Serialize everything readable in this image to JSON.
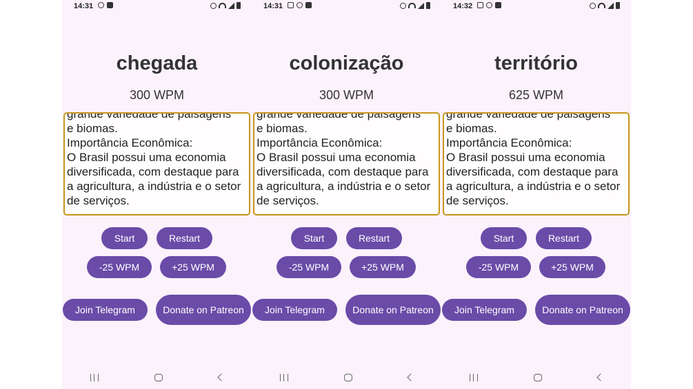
{
  "phones": [
    {
      "status": {
        "time": "14:31"
      },
      "word": "chegada",
      "wpm": "300 WPM",
      "text": "grande variedade de paisagens\ne biomas.\nImportância Econômica:\nO Brasil possui uma economia diversificada, com destaque para a agricultura, a indústria e o setor de serviços.",
      "buttons": {
        "start": "Start",
        "restart": "Restart",
        "minus": "-25 WPM",
        "plus": "+25 WPM",
        "telegram": "Join Telegram",
        "donate": "Donate on Patreon"
      }
    },
    {
      "status": {
        "time": "14:31"
      },
      "word": "colonização",
      "wpm": "300 WPM",
      "text": "grande variedade de paisagens\ne biomas.\nImportância Econômica:\nO Brasil possui uma economia diversificada, com destaque para a agricultura, a indústria e o setor de serviços.",
      "buttons": {
        "start": "Start",
        "restart": "Restart",
        "minus": "-25 WPM",
        "plus": "+25 WPM",
        "telegram": "Join Telegram",
        "donate": "Donate on Patreon"
      }
    },
    {
      "status": {
        "time": "14:32"
      },
      "word": "território",
      "wpm": "625 WPM",
      "text": "grande variedade de paisagens\ne biomas.\nImportância Econômica:\nO Brasil possui uma economia diversificada, com destaque para a agricultura, a indústria e o setor de serviços.",
      "buttons": {
        "start": "Start",
        "restart": "Restart",
        "minus": "-25 WPM",
        "plus": "+25 WPM",
        "telegram": "Join Telegram",
        "donate": "Donate on Patreon"
      }
    }
  ],
  "colors": {
    "accent": "#6a4ba8",
    "textbox_border": "#c7961c",
    "background": "#fbf2fb"
  }
}
